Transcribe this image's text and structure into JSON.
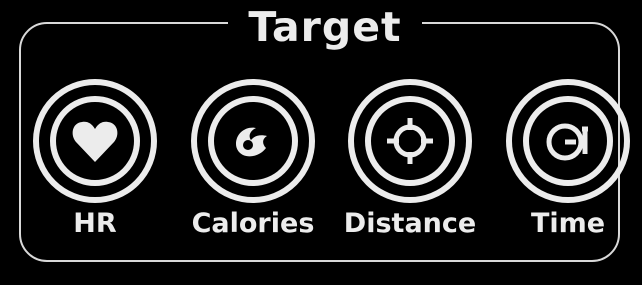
{
  "panel": {
    "title": "Target"
  },
  "targets": [
    {
      "label": "HR",
      "icon": "heart-icon"
    },
    {
      "label": "Calories",
      "icon": "flame-icon"
    },
    {
      "label": "Distance",
      "icon": "crosshair-icon"
    },
    {
      "label": "Time",
      "icon": "stopwatch-icon"
    }
  ],
  "colors": {
    "background": "#000000",
    "foreground": "#ececec"
  }
}
